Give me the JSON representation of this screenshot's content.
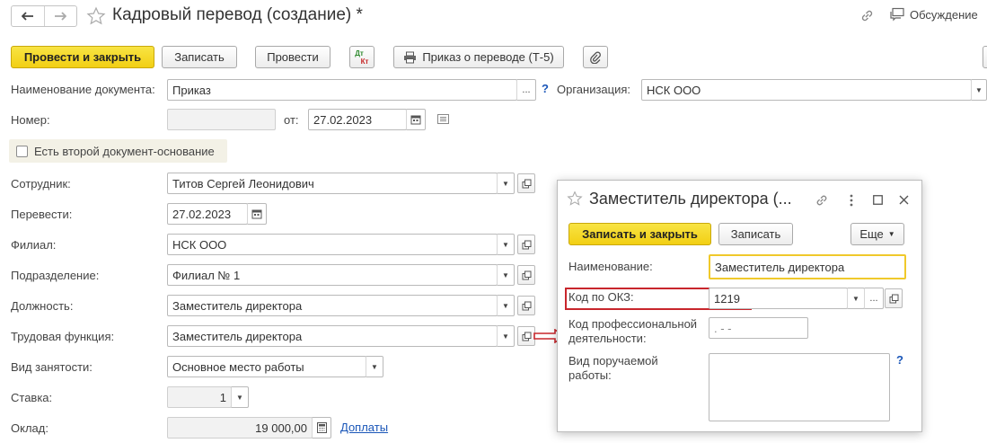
{
  "window": {
    "title": "Кадровый перевод (создание) *",
    "discussion_label": "Обсуждение"
  },
  "toolbar": {
    "post_close_label": "Провести и закрыть",
    "save_label": "Записать",
    "post_label": "Провести",
    "dtkt_top": "Дт",
    "dtkt_bottom": "Кт",
    "print_label": "Приказ о переводе (Т-5)"
  },
  "form": {
    "doc_name_label": "Наименование документа:",
    "doc_name_value": "Приказ",
    "help_mark": "?",
    "org_label": "Организация:",
    "org_value": "НСК ООО",
    "number_label": "Номер:",
    "number_value": "",
    "date_from_label": "от:",
    "date_value": "27.02.2023",
    "second_doc_label": "Есть второй документ-основание",
    "employee_label": "Сотрудник:",
    "employee_value": "Титов Сергей Леонидович",
    "transfer_label": "Перевести:",
    "transfer_value": "27.02.2023",
    "branch_label": "Филиал:",
    "branch_value": "НСК ООО",
    "department_label": "Подразделение:",
    "department_value": "Филиал № 1",
    "position_label": "Должность:",
    "position_value": "Заместитель директора",
    "labor_function_label": "Трудовая функция:",
    "labor_function_value": "Заместитель директора",
    "employment_type_label": "Вид занятости:",
    "employment_type_value": "Основное место работы",
    "rate_label": "Ставка:",
    "rate_value": "1",
    "salary_label": "Оклад:",
    "salary_value": "19 000,00",
    "extras_link": "Доплаты"
  },
  "dialog": {
    "title": "Заместитель директора (...",
    "save_close_label": "Записать и закрыть",
    "save_label": "Записать",
    "more_label": "Еще",
    "name_label": "Наименование:",
    "name_value": "Заместитель директора",
    "okz_label": "Код по ОКЗ:",
    "okz_value": "1219",
    "prof_code_label_1": "Код профессиональной",
    "prof_code_label_2": "деятельности:",
    "prof_code_value": ".  - -",
    "work_type_label_1": "Вид поручаемой",
    "work_type_label_2": "работы:",
    "help_mark": "?"
  },
  "colors": {
    "primary_button": "#f2cf14",
    "highlight_border": "#c8262c",
    "link": "#1a56b8",
    "focus_border": "#f0c92b"
  },
  "icons": [
    "back-arrow-icon",
    "forward-arrow-icon",
    "star-icon",
    "link-icon",
    "discussion-icon",
    "printer-icon",
    "paperclip-icon",
    "calendar-icon",
    "list-icon",
    "open-icon",
    "close-icon",
    "maximize-icon",
    "more-icon",
    "arrow-right-icon"
  ]
}
